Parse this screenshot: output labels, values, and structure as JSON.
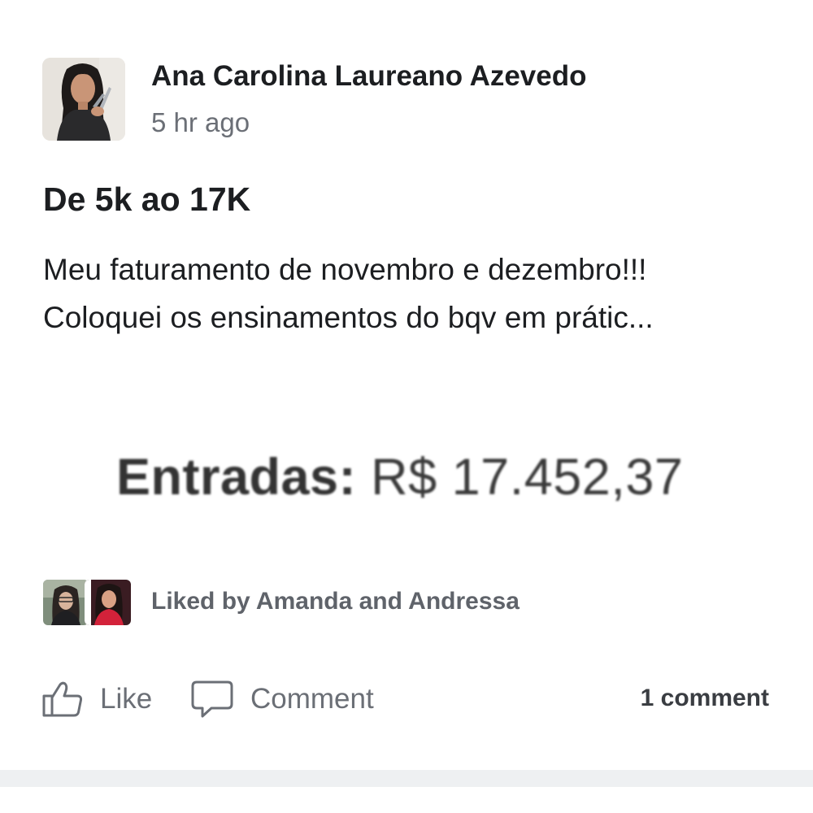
{
  "post": {
    "author_name": "Ana Carolina Laureano Azevedo",
    "timestamp": "5 hr ago",
    "title": "De 5k ao 17K",
    "body_lines": [
      "Meu faturamento de novembro e dezembro!!!",
      "Coloquei os ensinamentos do bqv em prátic..."
    ],
    "image": {
      "label": "Entradas:",
      "amount": "R$ 17.452,37"
    },
    "likes": {
      "text": "Liked by Amanda and Andressa"
    },
    "actions": {
      "like_label": "Like",
      "comment_label": "Comment",
      "comment_count": "1 comment"
    }
  },
  "icons": {
    "like": "thumbs-up-icon",
    "comment": "speech-bubble-icon"
  },
  "colors": {
    "text_primary": "#1c1e21",
    "text_secondary": "#6b6f76",
    "divider": "#eef0f2"
  }
}
